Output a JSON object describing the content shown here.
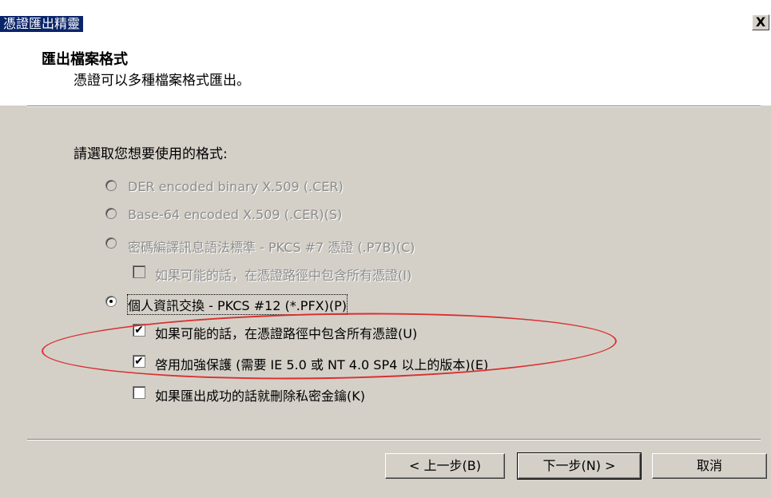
{
  "window": {
    "title": "憑證匯出精靈",
    "close_label": "X"
  },
  "header": {
    "title": "匯出檔案格式",
    "subtitle": "憑證可以多種檔案格式匯出。"
  },
  "prompt": "請選取您想要使用的格式:",
  "options": {
    "der": {
      "label": "DER encoded binary X.509 (.CER)",
      "enabled": false,
      "selected": false
    },
    "base64": {
      "label": "Base-64 encoded X.509 (.CER)(S)",
      "enabled": false,
      "selected": false
    },
    "pkcs7": {
      "label": "密碼編譯訊息語法標準 - PKCS #7 憑證 (.P7B)(C)",
      "enabled": false,
      "selected": false
    },
    "pkcs7_include_all": {
      "label": "如果可能的話，在憑證路徑中包含所有憑證(I)",
      "enabled": false,
      "checked": false
    },
    "pfx": {
      "label": "個人資訊交換 - PKCS #12 (*.PFX)(P)",
      "enabled": true,
      "selected": true
    },
    "pfx_include_all": {
      "label": "如果可能的話，在憑證路徑中包含所有憑證(U)",
      "enabled": true,
      "checked": true
    },
    "pfx_strong_protection": {
      "label": "啓用加強保護 (需要 IE 5.0 或 NT 4.0 SP4 以上的版本)(E)",
      "enabled": true,
      "checked": true
    },
    "pfx_delete_key": {
      "label": "如果匯出成功的話就刪除私密金鑰(K)",
      "enabled": true,
      "checked": false
    }
  },
  "buttons": {
    "back": "< 上一步(B)",
    "next": "下一步(N) >",
    "cancel": "取消"
  },
  "icons": {
    "check": "✔"
  },
  "colors": {
    "titlebar": "#0a246a",
    "annotation_oval": "#d93030",
    "dialog_face": "#d4d0c8"
  }
}
